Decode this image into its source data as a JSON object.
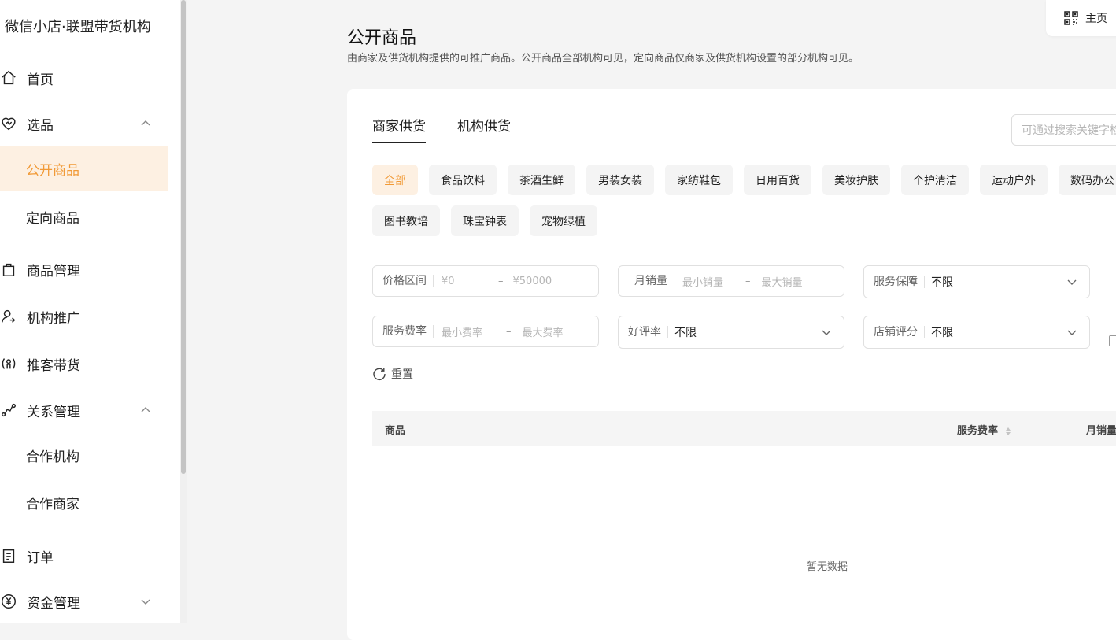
{
  "sidebar": {
    "brand": "微信小店·联盟带货机构",
    "items": [
      {
        "label": "首页",
        "icon": "home-icon"
      },
      {
        "label": "选品",
        "icon": "heart-check-icon"
      },
      {
        "label": "公开商品"
      },
      {
        "label": "定向商品"
      },
      {
        "label": "商品管理",
        "icon": "shopping-bag-icon"
      },
      {
        "label": "机构推广",
        "icon": "user-share-icon"
      },
      {
        "label": "推客带货",
        "icon": "person-broadcast-icon"
      },
      {
        "label": "关系管理",
        "icon": "relation-icon"
      },
      {
        "label": "合作机构"
      },
      {
        "label": "合作商家"
      },
      {
        "label": "订单",
        "icon": "order-icon"
      },
      {
        "label": "资金管理",
        "icon": "yuan-icon"
      }
    ]
  },
  "topbar": {
    "home_label": "主页",
    "home_icon": "qrcode-icon"
  },
  "page": {
    "title": "公开商品",
    "description": "由商家及供货机构提供的可推广商品。公开商品全部机构可见，定向商品仅商家及供货机构设置的部分机构可见。"
  },
  "tabs": [
    {
      "label": "商家供货",
      "active": true
    },
    {
      "label": "机构供货",
      "active": false
    }
  ],
  "search": {
    "placeholder": "可通过搜索关键字检"
  },
  "categories": [
    "全部",
    "食品饮料",
    "茶酒生鲜",
    "男装女装",
    "家纺鞋包",
    "日用百货",
    "美妆护肤",
    "个护清洁",
    "运动户外",
    "数码办公",
    "图书教培",
    "珠宝钟表",
    "宠物绿植"
  ],
  "filters": {
    "price": {
      "label": "价格区间",
      "min": "¥0",
      "dash": "–",
      "max": "¥50000"
    },
    "monthly_sales": {
      "label": "月销量",
      "min": "最小销量",
      "dash": "–",
      "max": "最大销量"
    },
    "service_guarantee": {
      "label": "服务保障",
      "value": "不限"
    },
    "service_rate": {
      "label": "服务费率",
      "min": "最小费率",
      "dash": "–",
      "max": "最大费率"
    },
    "rating": {
      "label": "好评率",
      "value": "不限"
    },
    "store_score": {
      "label": "店铺评分",
      "value": "不限"
    }
  },
  "reset_label": "重置",
  "table": {
    "columns": [
      "商品",
      "服务费率",
      "月销量"
    ],
    "empty_text": "暂无数据"
  },
  "colors": {
    "accent": "#f19a37",
    "accent_bg": "#fdf0e2"
  }
}
